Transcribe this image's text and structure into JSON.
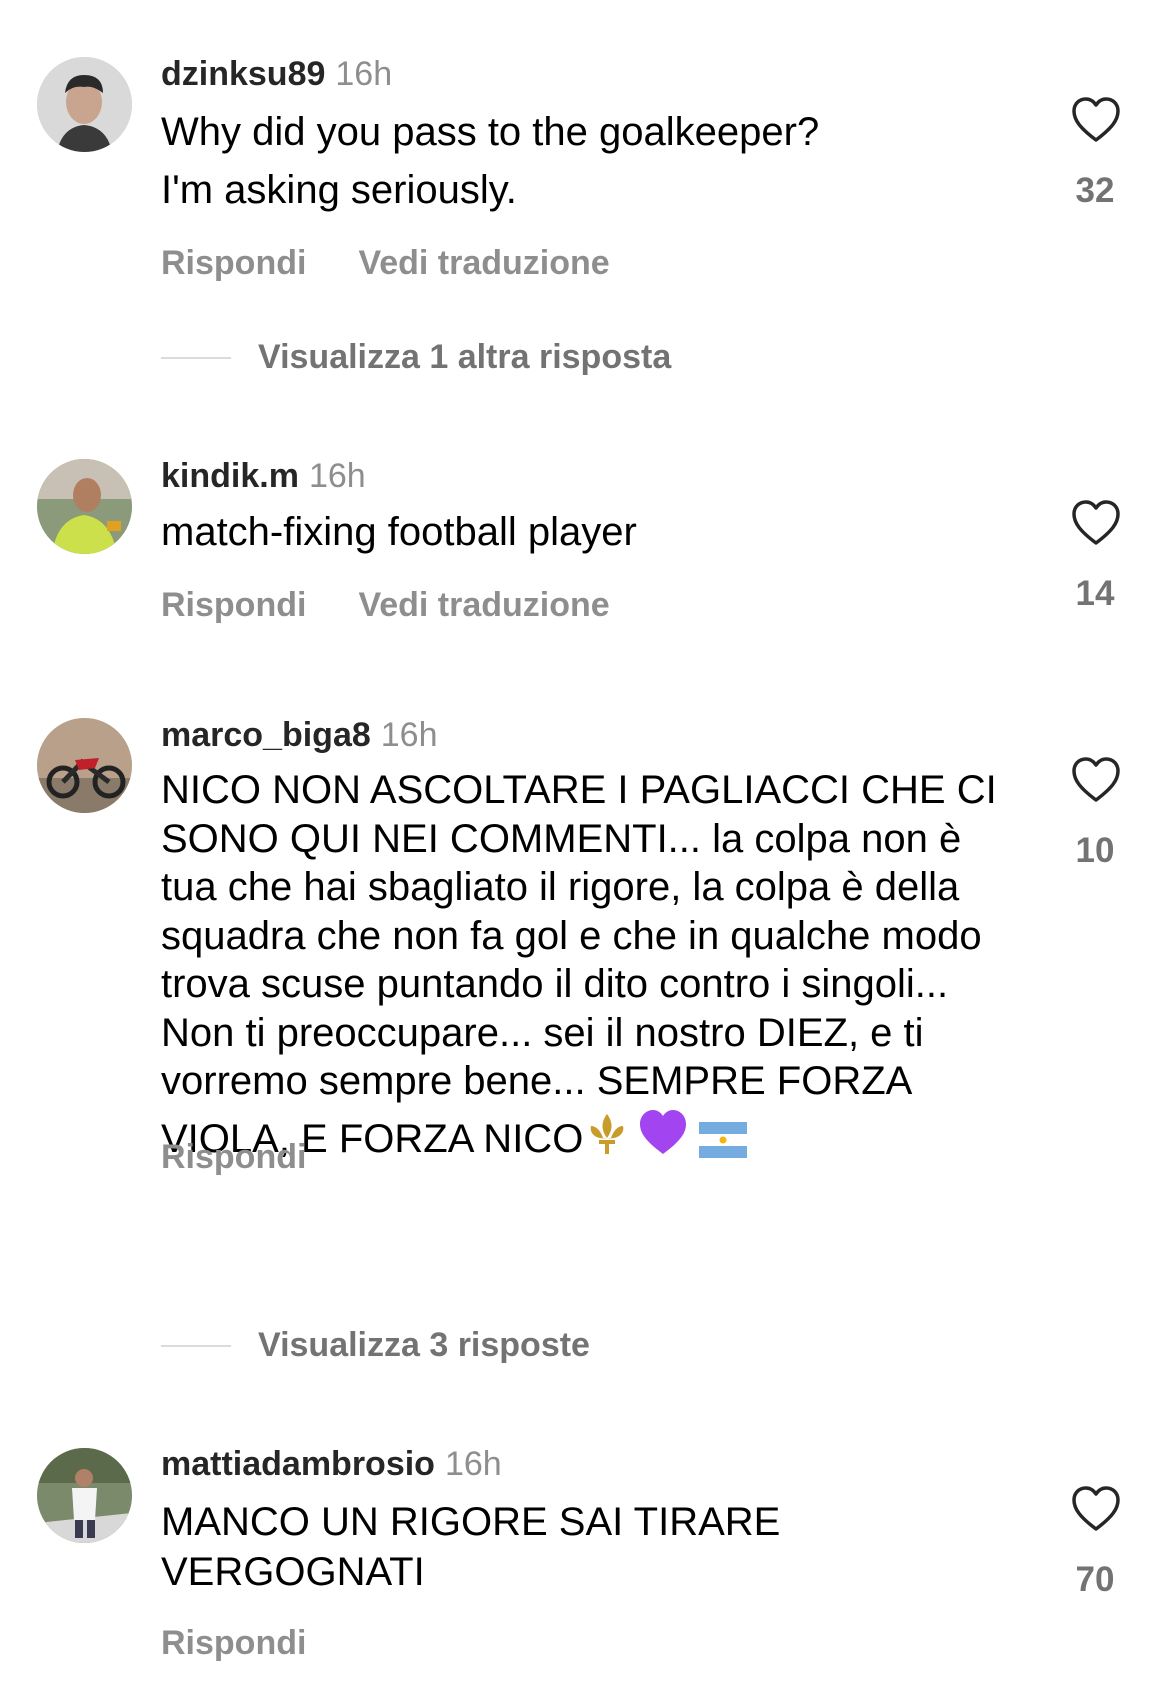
{
  "comments": [
    {
      "username": "dzinksu89",
      "time": "16h",
      "text": "Why did you pass to the goalkeeper?\nI'm asking seriously.",
      "reply_label": "Rispondi",
      "translate_label": "Vedi traduzione",
      "likes": "32",
      "view_replies": "Visualizza 1 altra risposta"
    },
    {
      "username": "kindik.m",
      "time": "16h",
      "text": "match-fixing football player",
      "reply_label": "Rispondi",
      "translate_label": "Vedi traduzione",
      "likes": "14"
    },
    {
      "username": "marco_biga8",
      "time": "16h",
      "text": "NICO NON ASCOLTARE I PAGLIACCI CHE CI SONO QUI NEI COMMENTI... la colpa non è tua che hai sbagliato il rigore, la colpa è della squadra che non fa gol e che in qualche modo trova scuse puntando il dito contro i singoli... Non ti preoccupare... sei il nostro DIEZ, e ti vorremo sempre bene... SEMPRE FORZA VIOLA, E FORZA NICO",
      "emojis": [
        "fleur-de-lis",
        "purple-heart",
        "argentina-flag"
      ],
      "reply_label": "Rispondi",
      "likes": "10",
      "view_replies": "Visualizza 3 risposte"
    },
    {
      "username": "mattiadambrosio",
      "time": "16h",
      "text": "MANCO UN RIGORE SAI TIRARE\nVERGOGNATI",
      "reply_label": "Rispondi",
      "likes": "70"
    }
  ],
  "icons": {
    "like": "heart-outline-icon"
  },
  "colors": {
    "muted": "#8e8e8e",
    "text": "#000000",
    "username": "#262626"
  }
}
